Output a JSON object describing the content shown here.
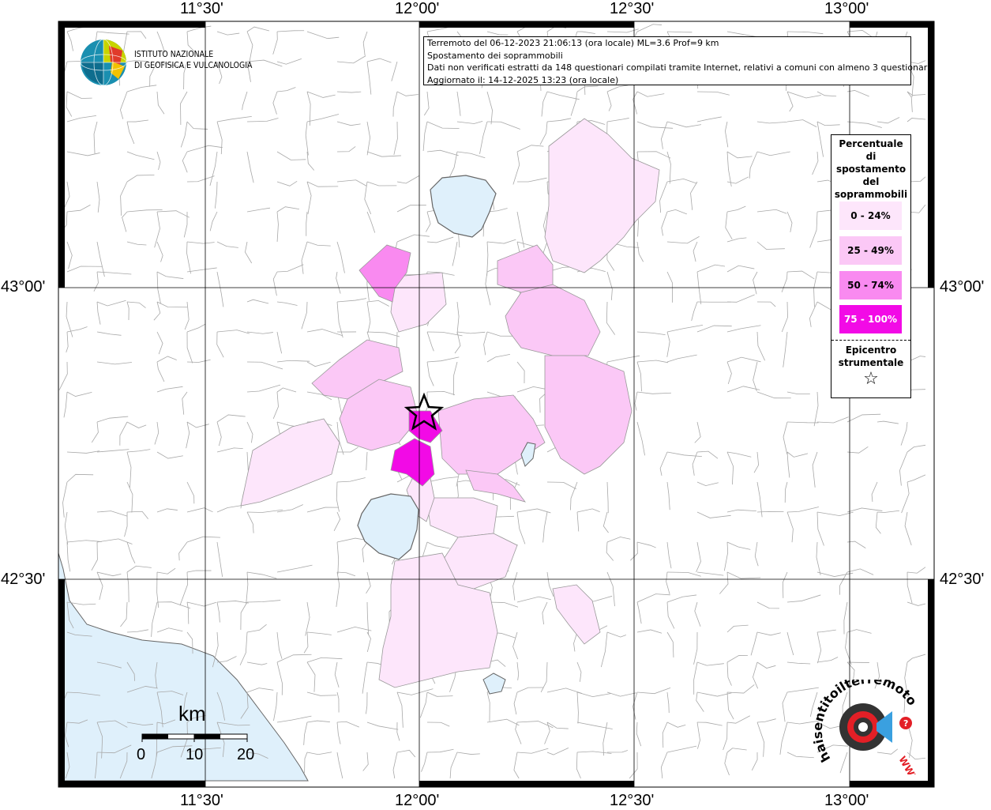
{
  "map": {
    "lon_ticks": [
      "11°30'",
      "12°00'",
      "12°30'",
      "13°00'"
    ],
    "lat_ticks": [
      "43°00'",
      "42°30'"
    ]
  },
  "info": {
    "line1": "Terremoto del 06-12-2023 21:06:13 (ora locale) ML=3.6 Prof=9 km",
    "line2": "Spostamento dei soprammobili",
    "line3": "Dati non verificati estratti da 148 questionari compilati tramite Internet, relativi a comuni con almeno 3 questionari.",
    "line4": "Aggiornato il: 14-12-2025 13:23 (ora locale)"
  },
  "logo": {
    "line1": "ISTITUTO NAZIONALE",
    "line2": "DI GEOFISICA E VULCANOLOGIA"
  },
  "legend": {
    "title_lines": [
      "Percentuale",
      "di",
      "spostamento",
      "del",
      "soprammobili"
    ],
    "classes": [
      {
        "label": "0 - 24%",
        "color": "#fde6fb"
      },
      {
        "label": "25 - 49%",
        "color": "#fbc8f6"
      },
      {
        "label": "50 - 74%",
        "color": "#f98af0"
      },
      {
        "label": "75 - 100%",
        "color": "#f20ae6"
      }
    ],
    "epicenter_lines": [
      "Epicentro",
      "strumentale"
    ],
    "epicenter_symbol": "☆"
  },
  "scale": {
    "unit": "km",
    "labels": [
      "0",
      "10",
      "20"
    ]
  },
  "branding": {
    "arc_text": "haisentitoilterremoto.it",
    "www": "WWW"
  },
  "colors": {
    "sea": "#dff0fb",
    "lake": "#dff0fb",
    "border": "#a0a0a0",
    "frame": "#000000"
  }
}
